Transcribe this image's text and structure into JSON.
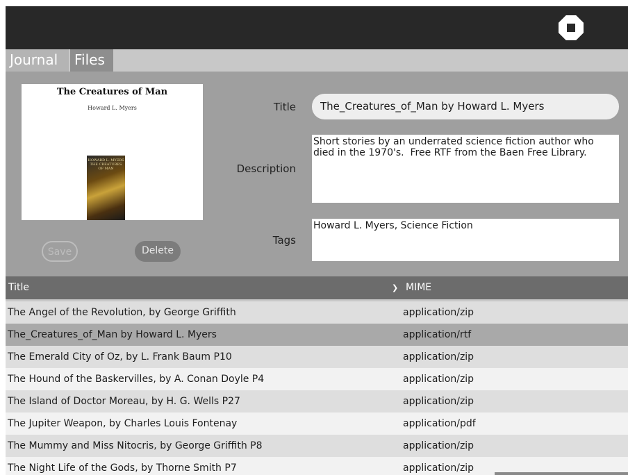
{
  "tabs": [
    {
      "label": "Journal"
    },
    {
      "label": "Files"
    }
  ],
  "preview": {
    "book_title": "The Creatures of Man",
    "book_author": "Howard L. Myers",
    "cover_text": "HOWARD L. MYERS THE CREATURES OF MAN"
  },
  "buttons": {
    "save": "Save",
    "delete": "Delete"
  },
  "fields": {
    "title_label": "Title",
    "title_value": "The_Creatures_of_Man by Howard L. Myers",
    "description_label": "Description",
    "description_value": "Short stories by an underrated science fiction author who died in the 1970's.  Free RTF from the Baen Free Library.",
    "tags_label": "Tags",
    "tags_value": "Howard L. Myers, Science Fiction"
  },
  "table": {
    "columns": [
      "Title",
      "MIME"
    ],
    "rows": [
      {
        "title": "The Angel of the Revolution, by George Griffith",
        "mime": "application/zip"
      },
      {
        "title": "The_Creatures_of_Man by Howard L. Myers",
        "mime": "application/rtf",
        "selected": true
      },
      {
        "title": "The Emerald City of Oz, by L. Frank Baum P10",
        "mime": "application/zip"
      },
      {
        "title": "The Hound of the Baskervilles, by A. Conan Doyle P4",
        "mime": "application/zip"
      },
      {
        "title": "The Island of Doctor Moreau, by H. G. Wells P27",
        "mime": "application/zip"
      },
      {
        "title": "The Jupiter Weapon, by Charles Louis Fontenay",
        "mime": "application/pdf"
      },
      {
        "title": "The Mummy and Miss Nitocris, by George Griffith P8",
        "mime": "application/zip"
      },
      {
        "title": "The Night Life of the Gods, by Thorne Smith P7",
        "mime": "application/zip"
      }
    ]
  },
  "icons": {
    "stop": "stop-icon",
    "sort": "chevron-down-icon",
    "pointer": "mouse-pointer-icon"
  },
  "colors": {
    "topbar": "#282828",
    "panel": "#9f9f9f",
    "header": "#6c6c6c",
    "selected_row": "#a9a9a9"
  }
}
